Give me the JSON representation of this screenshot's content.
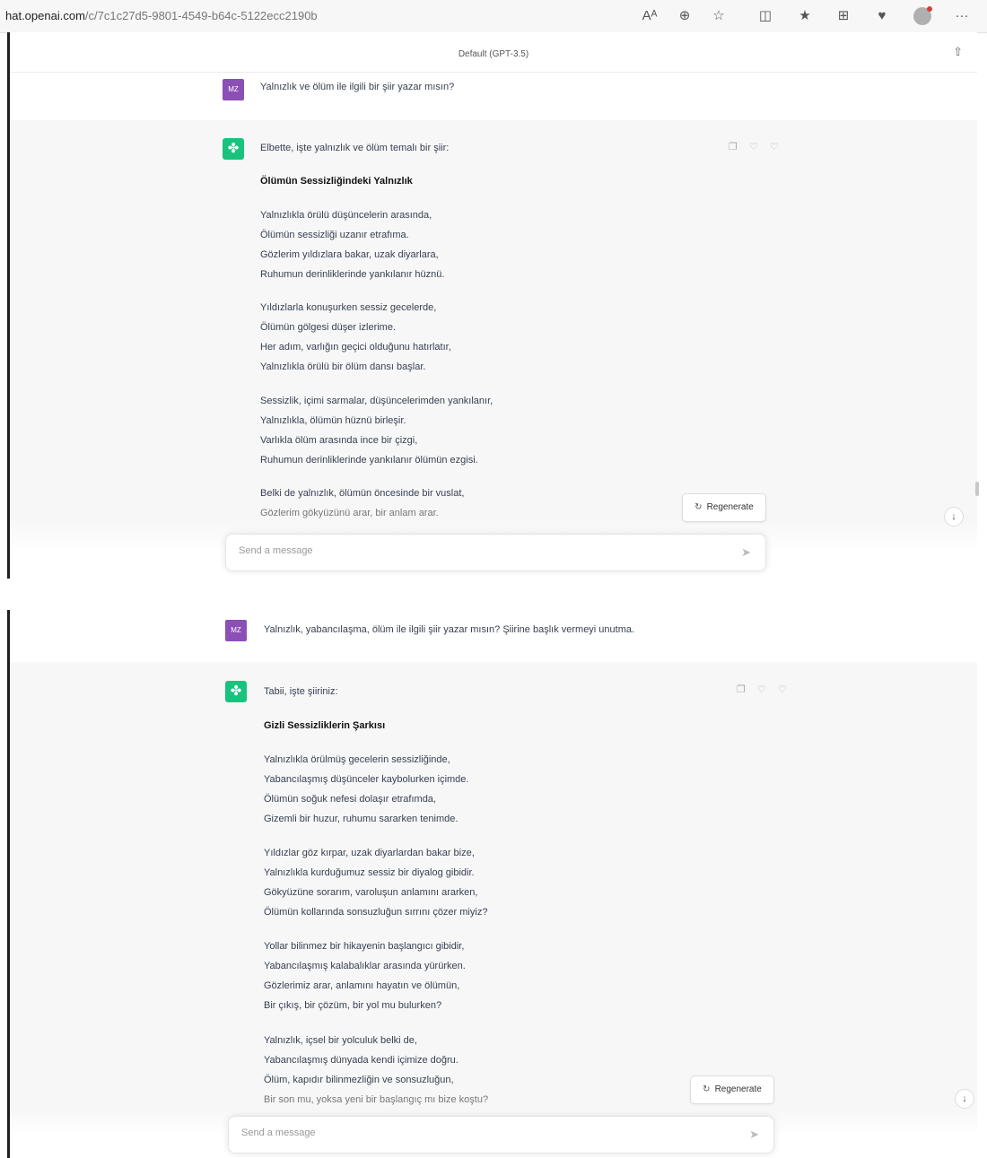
{
  "browser": {
    "url_domain": "hat.openai.com",
    "url_path": "/c/7c1c27d5-9801-4549-b64c-5122ecc2190b"
  },
  "model_label": "Default (GPT-3.5)",
  "icons": {
    "read_aloud": "Aᴬ",
    "zoom": "⊕",
    "favorite": "☆",
    "split": "◫",
    "favorites": "★",
    "collections": "⊞",
    "extensions": "♥",
    "more": "···",
    "share": "⇧",
    "send": "➤",
    "arrow_down": "↓",
    "regen": "↻",
    "feedback": "❐ ♡ ♡",
    "gpt_logo": "✤"
  },
  "panel1": {
    "user": {
      "avatar": "MZ",
      "text": "Yalnızlık ve ölüm ile ilgili bir şiir yazar mısın?"
    },
    "assistant": {
      "intro": "Elbette, işte yalnızlık ve ölüm temalı bir şiir:",
      "title": "Ölümün Sessizliğindeki Yalnızlık",
      "stanzas": [
        [
          "Yalnızlıkla örülü düşüncelerin arasında,",
          "Ölümün sessizliği uzanır etrafıma.",
          "Gözlerim yıldızlara bakar, uzak diyarlara,",
          "Ruhumun derinliklerinde yankılanır hüznü."
        ],
        [
          "Yıldızlarla konuşurken sessiz gecelerde,",
          "Ölümün gölgesi düşer izlerime.",
          "Her adım, varlığın geçici olduğunu hatırlatır,",
          "Yalnızlıkla örülü bir ölüm dansı başlar."
        ],
        [
          "Sessizlik, içimi sarmalar, düşüncelerimden yankılanır,",
          "Yalnızlıkla, ölümün hüznü birleşir.",
          "Varlıkla ölüm arasında ince bir çizgi,",
          "Ruhumun derinliklerinde yankılanır ölümün ezgisi."
        ],
        [
          "Belki de yalnızlık, ölümün öncesinde bir vuslat,",
          "Gözlerim gökyüzünü arar, bir anlam arar."
        ]
      ]
    },
    "regenerate": "Regenerate",
    "input_placeholder": "Send a message"
  },
  "panel2": {
    "user": {
      "avatar": "MZ",
      "text": "Yalnızlık, yabancılaşma, ölüm ile ilgili şiir yazar mısın? Şiirine başlık vermeyi unutma."
    },
    "assistant": {
      "intro": "Tabii, işte şiiriniz:",
      "title": "Gizli Sessizliklerin Şarkısı",
      "stanzas": [
        [
          "Yalnızlıkla örülmüş gecelerin sessizliğinde,",
          "Yabancılaşmış düşünceler kaybolurken içimde.",
          "Ölümün soğuk nefesi dolaşır etrafımda,",
          "Gizemli bir huzur, ruhumu sararken tenimde."
        ],
        [
          "Yıldızlar göz kırpar, uzak diyarlardan bakar bize,",
          "Yalnızlıkla kurduğumuz sessiz bir diyalog gibidir.",
          "Gökyüzüne sorarım, varoluşun anlamını ararken,",
          "Ölümün kollarında sonsuzluğun sırrını çözer miyiz?"
        ],
        [
          "Yollar bilinmez bir hikayenin başlangıcı gibidir,",
          "Yabancılaşmış kalabalıklar arasında yürürken.",
          "Gözlerimiz arar, anlamını hayatın ve ölümün,",
          "Bir çıkış, bir çözüm, bir yol mu bulurken?"
        ],
        [
          "Yalnızlık, içsel bir yolculuk belki de,",
          "Yabancılaşmış dünyada kendi içimize doğru.",
          "Ölüm, kapıdır bilinmezliğin ve sonsuzluğun,",
          "Bir son mu, yoksa yeni bir başlangıç mı bize koştu?"
        ]
      ]
    },
    "regenerate": "Regenerate",
    "input_placeholder": "Send a message"
  }
}
